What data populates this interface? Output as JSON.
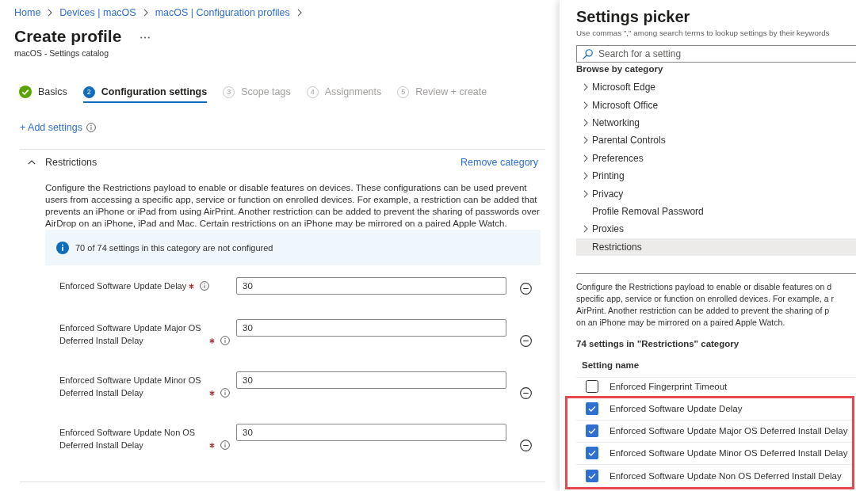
{
  "breadcrumb": [
    {
      "label": "Home"
    },
    {
      "label": "Devices | macOS"
    },
    {
      "label": "macOS | Configuration profiles"
    }
  ],
  "page": {
    "title": "Create profile",
    "subtitle": "macOS - Settings catalog"
  },
  "steps": [
    {
      "label": "Basics",
      "completed": true,
      "selected": false
    },
    {
      "number": "2",
      "label": "Configuration settings",
      "completed": false,
      "selected": true
    },
    {
      "number": "3",
      "label": "Scope tags",
      "completed": false,
      "selected": false
    },
    {
      "number": "4",
      "label": "Assignments",
      "completed": false,
      "selected": false
    },
    {
      "number": "5",
      "label": "Review + create",
      "completed": false,
      "selected": false
    }
  ],
  "add_settings": {
    "label": "+ Add settings"
  },
  "category": {
    "title": "Restrictions",
    "expanded": true,
    "remove_label": "Remove category",
    "description": "Configure the Restrictions payload to enable or disable features on devices. These configurations can be used prevent users from accessing a specific app, service or function on enrolled devices. For example, a restriction can be added that prevents an iPhone or iPad from using AirPrint. Another restriction can be added to prevent the sharing of passwords over AirDrop on an iPhone, iPad and Mac. Certain restrictions on an iPhone may be mirrored on a paired Apple Watch.",
    "notice": "70 of 74 settings in this category are not configured",
    "settings": [
      {
        "label": "Enforced Software Update Delay",
        "required": true,
        "value": "30"
      },
      {
        "label": "Enforced Software Update Major OS Deferred Install Delay",
        "required": true,
        "value": "30"
      },
      {
        "label": "Enforced Software Update Minor OS Deferred Install Delay",
        "required": true,
        "value": "30"
      },
      {
        "label": "Enforced Software Update Non OS Deferred Install Delay",
        "required": true,
        "value": "30"
      }
    ]
  },
  "picker": {
    "title": "Settings picker",
    "hint": "Use commas \",\" among search terms to lookup settings by their keywords",
    "search": {
      "placeholder": "Search for a setting"
    },
    "browse_heading": "Browse by category",
    "categories": [
      {
        "label": "Microsoft Edge",
        "expandable": true,
        "selected": false
      },
      {
        "label": "Microsoft Office",
        "expandable": true,
        "selected": false
      },
      {
        "label": "Networking",
        "expandable": true,
        "selected": false
      },
      {
        "label": "Parental Controls",
        "expandable": true,
        "selected": false
      },
      {
        "label": "Preferences",
        "expandable": true,
        "selected": false
      },
      {
        "label": "Printing",
        "expandable": true,
        "selected": false
      },
      {
        "label": "Privacy",
        "expandable": true,
        "selected": false
      },
      {
        "label": "Profile Removal Password",
        "expandable": false,
        "selected": false
      },
      {
        "label": "Proxies",
        "expandable": true,
        "selected": false
      },
      {
        "label": "Restrictions",
        "expandable": false,
        "selected": true
      }
    ],
    "description_lines": [
      "Configure the Restrictions payload to enable or disable features on d",
      "specific app, service or function on enrolled devices. For example, a r",
      "AirPrint. Another restriction can be added to prevent the sharing of p",
      "on an iPhone may be mirrored on a paired Apple Watch."
    ],
    "count_label": "74 settings in \"Restrictions\" category",
    "table": {
      "columns": [
        "Setting name"
      ],
      "rows": [
        {
          "label": "Enforced Fingerprint Timeout",
          "checked": false,
          "highlighted": false
        },
        {
          "label": "Enforced Software Update Delay",
          "checked": true,
          "highlighted": true
        },
        {
          "label": "Enforced Software Update Major OS Deferred Install Delay",
          "checked": true,
          "highlighted": true
        },
        {
          "label": "Enforced Software Update Minor OS Deferred Install Delay",
          "checked": true,
          "highlighted": true
        },
        {
          "label": "Enforced Software Update Non OS Deferred Install Delay",
          "checked": true,
          "highlighted": true
        }
      ]
    }
  }
}
